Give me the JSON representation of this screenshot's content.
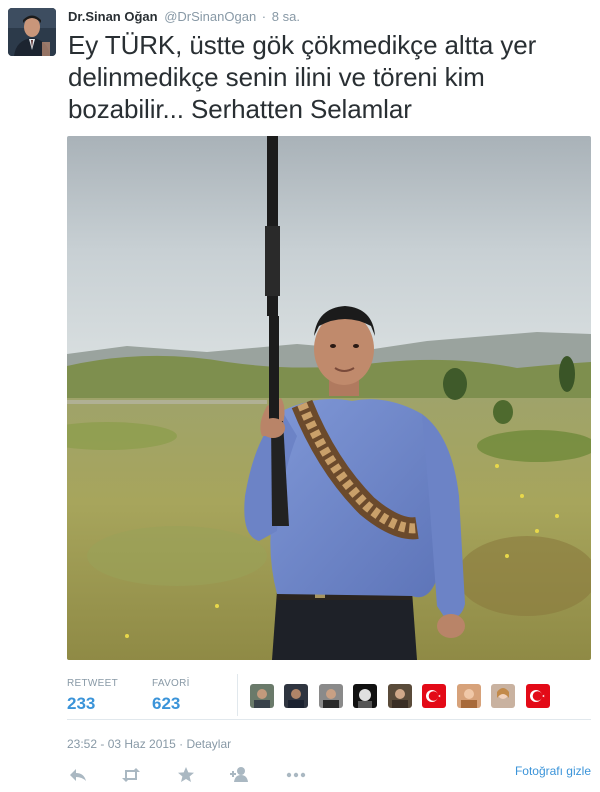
{
  "user": {
    "fullname": "Dr.Sinan Oğan",
    "username": "@DrSinanOgan",
    "separator": "·",
    "time": "8 sa."
  },
  "tweet": {
    "text": "Ey TÜRK, üstte gök çökmedikçe altta yer delinmedikçe senin ilini ve töreni kim bozabilir... Serhatten Selamlar"
  },
  "stats": {
    "retweet_label": "RETWEET",
    "retweet_count": "233",
    "favorite_label": "FAVORİ",
    "favorite_count": "623"
  },
  "favoriter_avatars": [
    "avatar-1",
    "avatar-2",
    "avatar-3",
    "avatar-4",
    "avatar-5",
    "turkish-flag-avatar",
    "avatar-7",
    "avatar-8",
    "turkish-flag-avatar"
  ],
  "meta": {
    "timestamp": "23:52 - 03 Haz 2015",
    "separator": "·",
    "details_link": "Detaylar"
  },
  "actions": {
    "icons": [
      "reply-icon",
      "retweet-icon",
      "favorite-icon",
      "follow-icon",
      "more-icon"
    ],
    "hide_photo": "Fotoğrafı gizle"
  },
  "colors": {
    "link_blue": "#3b94d9",
    "muted_gray": "#8899a6",
    "text": "#292f33",
    "divider": "#e1e8ed",
    "turkish_red": "#e30a17"
  }
}
